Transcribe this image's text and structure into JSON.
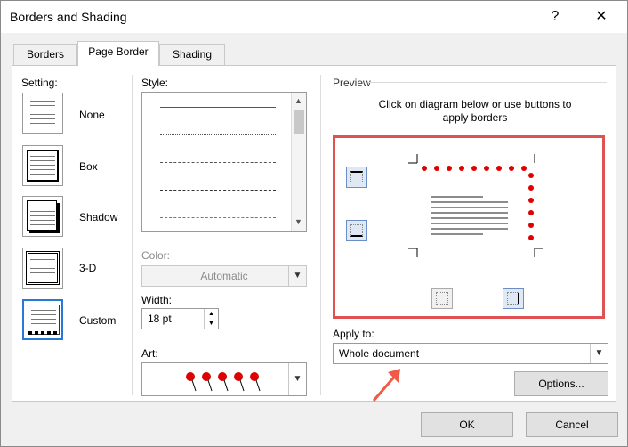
{
  "window": {
    "title": "Borders and Shading",
    "help": "?",
    "close": "✕"
  },
  "tabs": [
    {
      "label": "Borders"
    },
    {
      "label": "Page Border"
    },
    {
      "label": "Shading"
    }
  ],
  "setting": {
    "label": "Setting:",
    "items": [
      {
        "label": "None"
      },
      {
        "label": "Box"
      },
      {
        "label": "Shadow"
      },
      {
        "label": "3-D"
      },
      {
        "label": "Custom"
      }
    ],
    "selected": "Custom"
  },
  "style": {
    "label": "Style:",
    "lines": [
      "solid",
      "dotted",
      "dash-small",
      "dash",
      "dash-dot"
    ]
  },
  "color": {
    "label": "Color:",
    "value": "Automatic"
  },
  "width": {
    "label": "Width:",
    "value": "18 pt"
  },
  "art": {
    "label": "Art:"
  },
  "preview": {
    "label": "Preview",
    "instruction": "Click on diagram below or use buttons to apply borders",
    "highlight_color": "#e05252"
  },
  "apply_to": {
    "label": "Apply to:",
    "value": "Whole document"
  },
  "buttons": {
    "options": "Options...",
    "ok": "OK",
    "cancel": "Cancel"
  },
  "arrow_color": "#f05a46"
}
